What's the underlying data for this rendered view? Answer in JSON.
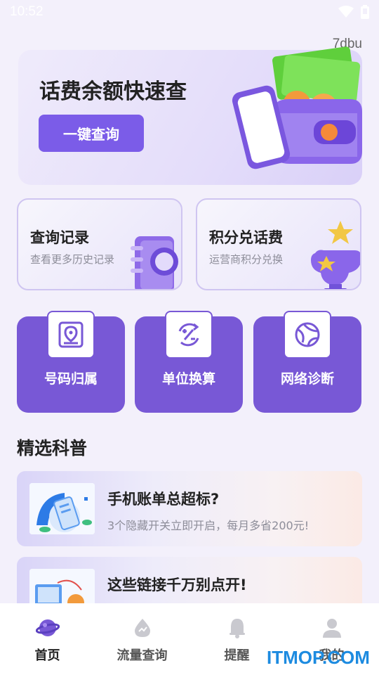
{
  "status_bar": {
    "time": "10:52"
  },
  "watermark_top": "7dbu",
  "banner": {
    "title": "话费余额快速查",
    "button_label": "一键查询"
  },
  "cards": [
    {
      "title": "查询记录",
      "subtitle": "查看更多历史记录"
    },
    {
      "title": "积分兑话费",
      "subtitle": "运营商积分兑换"
    }
  ],
  "tools": [
    {
      "label": "号码归属",
      "icon": "location-card-icon"
    },
    {
      "label": "单位换算",
      "icon": "conversion-icon"
    },
    {
      "label": "网络诊断",
      "icon": "globe-icon"
    }
  ],
  "section": {
    "title": "精选科普"
  },
  "articles": [
    {
      "title": "手机账单总超标?",
      "subtitle": "3个隐藏开关立即开启，每月多省200元!"
    },
    {
      "title": "这些链接千万别点开!",
      "subtitle": ""
    }
  ],
  "bottom_nav": [
    {
      "label": "首页",
      "icon": "planet-icon",
      "active": true
    },
    {
      "label": "流量查询",
      "icon": "traffic-icon",
      "active": false
    },
    {
      "label": "提醒",
      "icon": "bell-icon",
      "active": false
    },
    {
      "label": "我的",
      "icon": "user-icon",
      "active": false
    }
  ],
  "watermark_bottom": "ITMOP.COM",
  "colors": {
    "accent": "#7858d6",
    "button": "#7b5ce8",
    "background": "#f3f0fb"
  }
}
